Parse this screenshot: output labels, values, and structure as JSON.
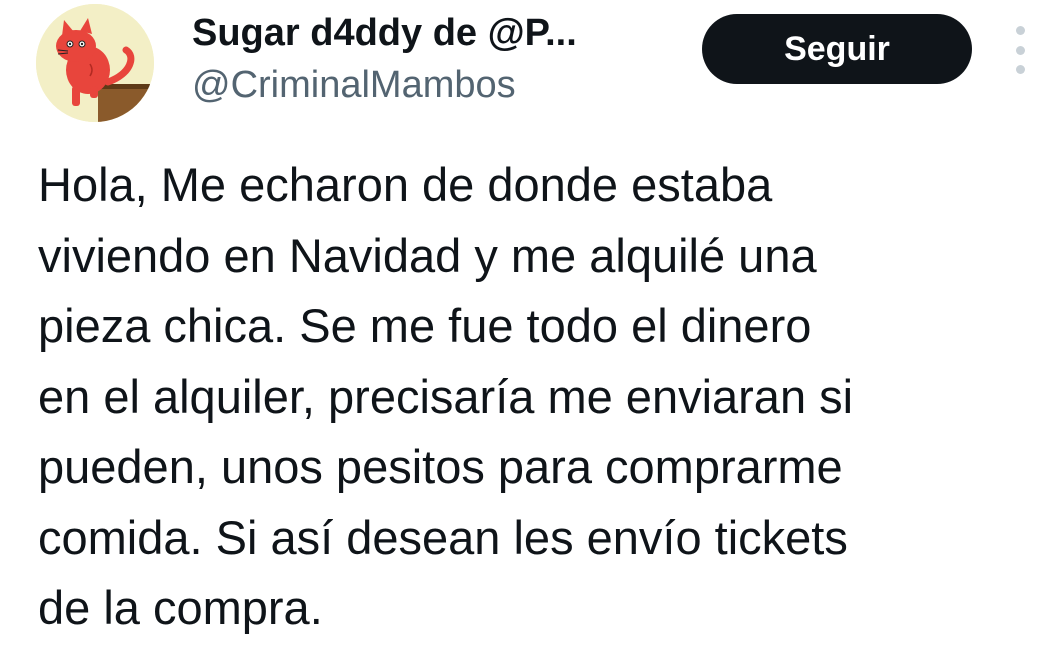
{
  "author": {
    "display_name": "Sugar d4ddy de @P...",
    "handle": "@CriminalMambos",
    "avatar_icon": "red-cat-avatar"
  },
  "actions": {
    "follow_label": "Seguir",
    "more_icon": "more-vertical-icon"
  },
  "tweet": {
    "lines": [
      "Hola, Me echaron de donde estaba",
      "viviendo en Navidad y me alquilé una",
      "pieza chica. Se me fue todo el dinero",
      "en el alquiler, precisaría me enviaran si",
      "pueden, unos pesitos para comprarme",
      "comida. Si así desean les envío tickets",
      "de la compra."
    ]
  },
  "colors": {
    "text_primary": "#0f1419",
    "text_secondary": "#536471",
    "button_bg": "#0f1419",
    "button_text": "#ffffff",
    "avatar_bg": "#f3efc6",
    "cat_red": "#e8453c"
  }
}
